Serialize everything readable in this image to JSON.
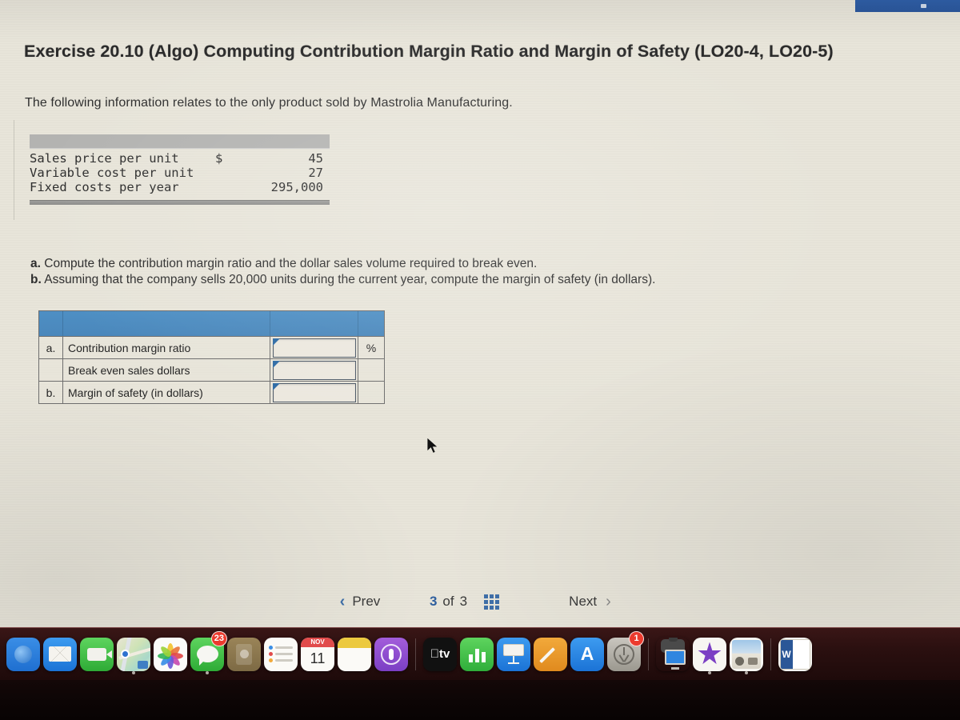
{
  "title": "Exercise 20.10 (Algo) Computing Contribution Margin Ratio and Margin of Safety (LO20-4, LO20-5)",
  "intro": "The following information relates to the only product sold by Mastrolia Manufacturing.",
  "given_table": {
    "rows": [
      {
        "label": "Sales price per unit",
        "currency": "$",
        "value": "45"
      },
      {
        "label": "Variable cost per unit",
        "currency": "",
        "value": "27"
      },
      {
        "label": "Fixed costs per year",
        "currency": "",
        "value": "295,000"
      }
    ]
  },
  "requirements": [
    {
      "marker": "a.",
      "text": "Compute the contribution margin ratio and the dollar sales volume required to break even."
    },
    {
      "marker": "b.",
      "text": "Assuming that the company sells 20,000 units during the current year, compute the margin of safety (in dollars)."
    }
  ],
  "answer_table": {
    "rows": [
      {
        "index": "a.",
        "label": "Contribution margin ratio",
        "value": "",
        "unit": "%"
      },
      {
        "index": "",
        "label": "Break even sales dollars",
        "value": "",
        "unit": ""
      },
      {
        "index": "b.",
        "label": "Margin of safety (in dollars)",
        "value": "",
        "unit": ""
      }
    ]
  },
  "pager": {
    "prev_label": "Prev",
    "prev_icon": "chevron-left-icon",
    "current_page": "3",
    "of_label": "of",
    "total_pages": "3",
    "grid_icon": "grid-3x3-icon",
    "next_label": "Next",
    "next_icon": "chevron-right-icon"
  },
  "dock": {
    "items": [
      {
        "name": "finder",
        "label": "",
        "running": false,
        "badge": ""
      },
      {
        "name": "mail",
        "label": "",
        "running": false,
        "badge": ""
      },
      {
        "name": "facetime",
        "label": "",
        "running": false,
        "badge": ""
      },
      {
        "name": "maps",
        "label": "",
        "running": true,
        "badge": ""
      },
      {
        "name": "photos",
        "label": "",
        "running": false,
        "badge": ""
      },
      {
        "name": "messages",
        "label": "",
        "running": true,
        "badge": "23"
      },
      {
        "name": "contacts",
        "label": "",
        "running": false,
        "badge": ""
      },
      {
        "name": "reminders",
        "label": "",
        "running": false,
        "badge": ""
      },
      {
        "name": "calendar",
        "label": "11",
        "month": "NOV",
        "running": false,
        "badge": ""
      },
      {
        "name": "notes",
        "label": "",
        "running": false,
        "badge": ""
      },
      {
        "name": "podcasts",
        "label": "",
        "running": false,
        "badge": ""
      },
      {
        "name": "apple-tv",
        "label": "tv",
        "running": false,
        "badge": ""
      },
      {
        "name": "numbers",
        "label": "",
        "running": false,
        "badge": ""
      },
      {
        "name": "keynote",
        "label": "",
        "running": false,
        "badge": ""
      },
      {
        "name": "pages",
        "label": "",
        "running": false,
        "badge": ""
      },
      {
        "name": "app-store",
        "label": "",
        "running": false,
        "badge": ""
      },
      {
        "name": "system-preferences",
        "label": "",
        "running": false,
        "badge": "1"
      },
      {
        "name": "image-capture",
        "label": "",
        "running": false,
        "badge": ""
      },
      {
        "name": "imovie",
        "label": "",
        "running": true,
        "badge": ""
      },
      {
        "name": "preview",
        "label": "",
        "running": true,
        "badge": ""
      },
      {
        "name": "word",
        "label": "W",
        "running": false,
        "badge": ""
      }
    ]
  },
  "colors": {
    "header_blue": "#4e8fc4",
    "link_blue": "#3f6fa8",
    "page_bg": "#e8e5da",
    "given_header_gray": "#b3b3b1"
  }
}
